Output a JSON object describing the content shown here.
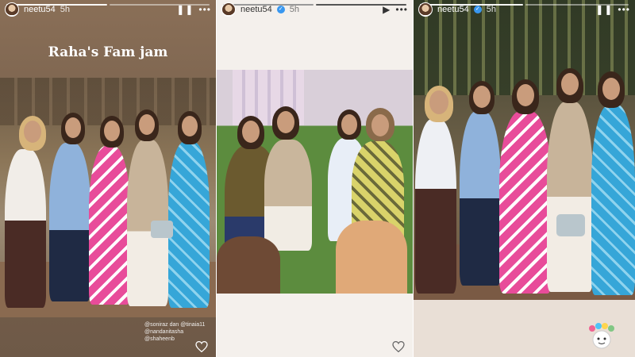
{
  "stories": [
    {
      "username": "neetu54",
      "time": "5h",
      "title": "Raha's Fam jam",
      "tags": [
        "@soniraz dan @tinaia11",
        "@nandanitasha",
        "@shaheenb"
      ],
      "progress_segments": 2,
      "active_segment": 0
    },
    {
      "username": "neetu54",
      "time": "5h",
      "progress_segments": 2,
      "active_segment": 1
    },
    {
      "username": "neetu54",
      "time": "5h",
      "progress_segments": 2,
      "active_segment": 0
    }
  ],
  "icons": {
    "pause": "pause-icon",
    "play": "play-icon",
    "more": "more-icon",
    "heart": "heart-icon",
    "verified": "verified-icon"
  },
  "colors": {
    "panel1_bg": "#7d6550",
    "panel2_bg": "#f4f0ec",
    "panel3_bg": "#e9dfd6",
    "verified": "#3897f0"
  }
}
